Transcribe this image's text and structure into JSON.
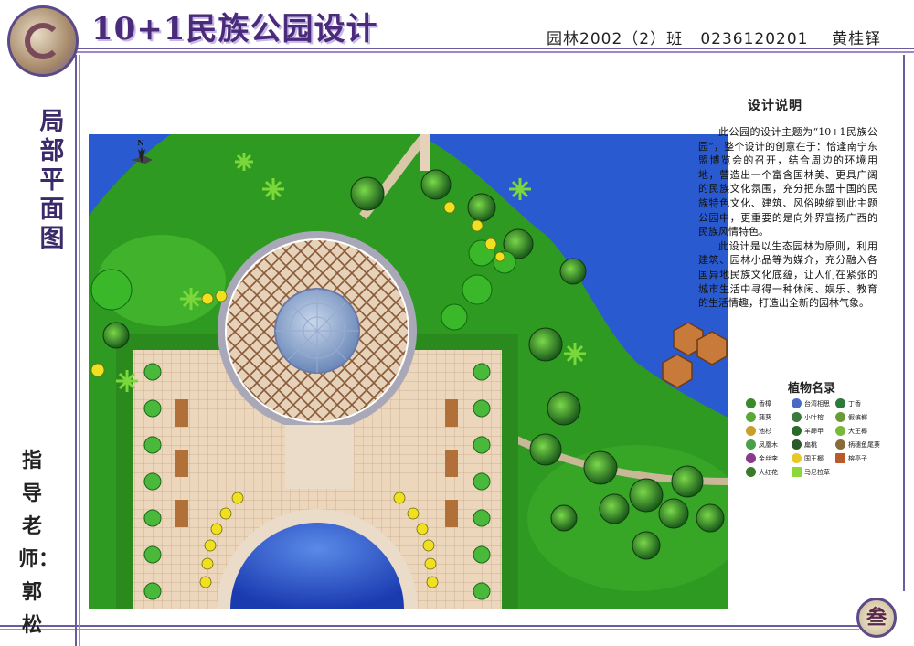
{
  "header": {
    "title": "10+1民族公园设计",
    "class_info": "园林2002（2）班",
    "student_id": "0236120201",
    "student_name": "黄桂铎"
  },
  "side": {
    "section_label": "局部平面图",
    "advisor_label": "指导老师：郭松"
  },
  "description": {
    "title": "设计说明",
    "paragraph1": "此公园的设计主题为“10+1民族公园”，整个设计的创意在于：恰逢南宁东盟博览会的召开，结合周边的环境用地，营造出一个富含国林美、更具广阔的民族文化氛围，充分把东盟十国的民族特色文化、建筑、风俗映缩到此主题公园中，更重要的是向外界宣扬广西的民族风情特色。",
    "paragraph2": "此设计是以生态园林为原则，利用建筑、园林小品等为媒介，充分融入各国异地民族文化底蕴，让人们在紧张的城市生活中寻得一种休闲、娱乐、教育的生活情趣，打造出全新的园林气象。"
  },
  "legend": {
    "title": "植物名录",
    "items": [
      {
        "label": "香樟",
        "color": "#3a8a2a"
      },
      {
        "label": "台湾相思",
        "color": "#4a6ac8"
      },
      {
        "label": "丁香",
        "color": "#2a7a3a"
      },
      {
        "label": "蒲葵",
        "color": "#5aa83a"
      },
      {
        "label": "小叶榕",
        "color": "#3a7a3a"
      },
      {
        "label": "假槟榔",
        "color": "#6a9a3a"
      },
      {
        "label": "池杉",
        "color": "#c8a028"
      },
      {
        "label": "羊蹄甲",
        "color": "#2a6a2a"
      },
      {
        "label": "大王椰",
        "color": "#7ab83a"
      },
      {
        "label": "凤凰木",
        "color": "#4aa04a"
      },
      {
        "label": "扁桃",
        "color": "#2a5a2a"
      },
      {
        "label": "柄穗鱼尾葵",
        "color": "#8a6a3a"
      },
      {
        "label": "金丝李",
        "color": "#8a3a8a"
      },
      {
        "label": "国王椰",
        "color": "#e8c828"
      },
      {
        "label": "榕亭子",
        "color": "#b85a2a"
      },
      {
        "label": "大红花",
        "color": "#3a7a2a"
      },
      {
        "label": "马尼拉草",
        "color": "#8ad83a"
      }
    ]
  },
  "compass": {
    "label": "N"
  },
  "page": {
    "number": "叁"
  },
  "colors": {
    "accent": "#4a2a7a",
    "water": "#2a5ad0",
    "grass": "#2e9a22",
    "paving": "#e6d2b8"
  }
}
